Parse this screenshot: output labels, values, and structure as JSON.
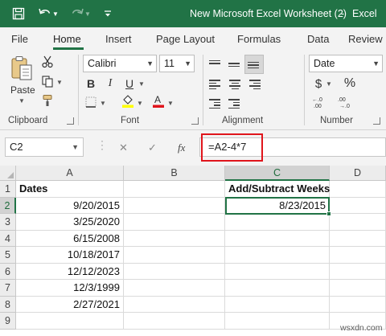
{
  "window": {
    "title": "New Microsoft Excel Worksheet (2)",
    "separator": "-",
    "app_name": "Excel"
  },
  "quick_access": {
    "icons": [
      "save-icon",
      "undo-icon",
      "redo-icon",
      "customize-icon"
    ]
  },
  "tabs": [
    "File",
    "Home",
    "Insert",
    "Page Layout",
    "Formulas",
    "Data",
    "Review"
  ],
  "active_tab": "Home",
  "ribbon": {
    "clipboard": {
      "label": "Clipboard",
      "paste_label": "Paste"
    },
    "font": {
      "label": "Font",
      "font_name": "Calibri",
      "font_size": "11",
      "bold": "B",
      "italic": "I",
      "underline": "U",
      "highlight_color": "#ffff00",
      "font_color": "#e0151c"
    },
    "alignment": {
      "label": "Alignment"
    },
    "number": {
      "label": "Number",
      "format": "Date",
      "currency": "$",
      "percent": "%"
    }
  },
  "formula_bar": {
    "name_box": "C2",
    "cancel_glyph": "✕",
    "enter_glyph": "✓",
    "fx_label": "fx",
    "formula": "=A2-4*7"
  },
  "grid": {
    "columns": [
      "A",
      "B",
      "C",
      "D"
    ],
    "rows": [
      "1",
      "2",
      "3",
      "4",
      "5",
      "6",
      "7",
      "8",
      "9"
    ],
    "header_A": "Dates",
    "header_C": "Add/Subtract Weeks",
    "dates": [
      "9/20/2015",
      "3/25/2020",
      "6/15/2008",
      "10/18/2017",
      "12/12/2023",
      "12/3/1999",
      "2/27/2021"
    ],
    "result_C2": "8/23/2015"
  },
  "watermark": "wsxdn.com",
  "colors": {
    "excel_green": "#217346",
    "highlight_red": "#e0151c"
  }
}
